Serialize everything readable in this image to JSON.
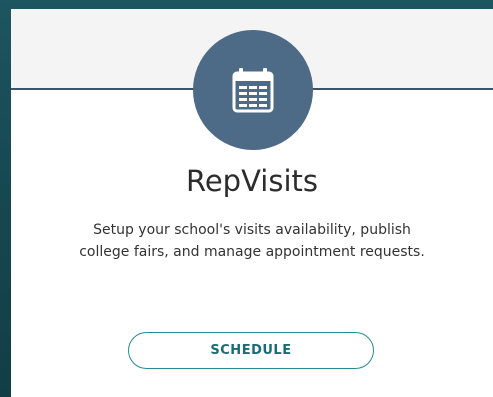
{
  "card": {
    "title": "RepVisits",
    "description_lines": [
      "Setup your school's visits availability, publish",
      "college fairs, and manage appointment requests."
    ],
    "action_label": "SCHEDULE",
    "icon": "calendar-icon"
  },
  "colors": {
    "background": "#174a54",
    "icon_circle": "#4d6a87",
    "divider": "#3d5368",
    "button_border": "#2a8a92",
    "button_text": "#166d76"
  }
}
